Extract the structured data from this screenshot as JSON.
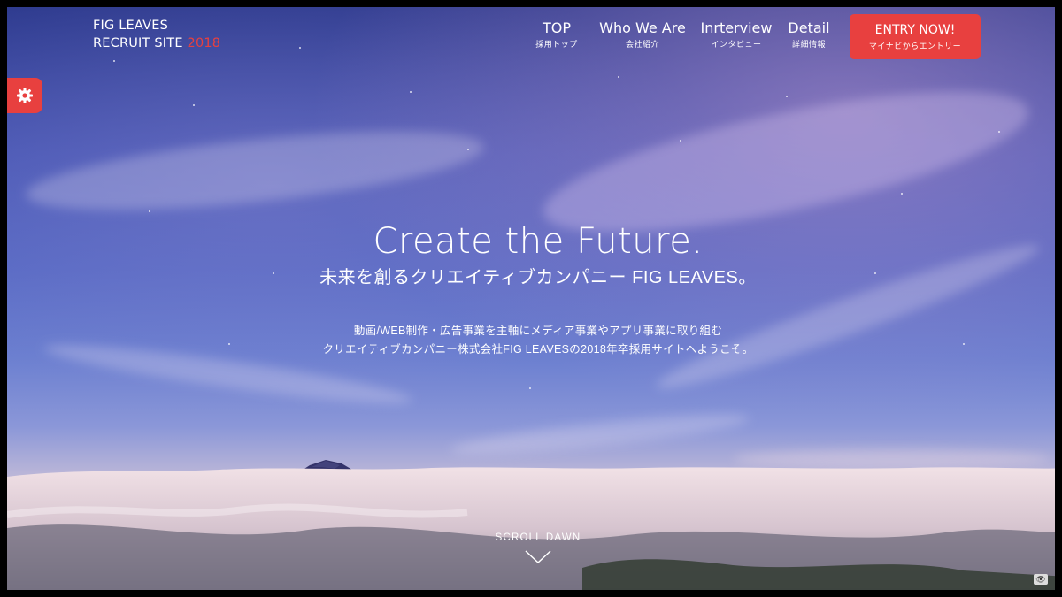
{
  "logo": {
    "line1": "FIG LEAVES",
    "line2_prefix": "RECRUIT SITE",
    "line2_year": "2018"
  },
  "nav": {
    "items": [
      {
        "label": "TOP",
        "sub": "採用トップ"
      },
      {
        "label": "Who We Are",
        "sub": "会社紹介"
      },
      {
        "label": "Inrterview",
        "sub": "インタビュー"
      },
      {
        "label": "Detail",
        "sub": "詳細情報"
      }
    ],
    "entry": {
      "label": "ENTRY NOW!",
      "sub": "マイナビからエントリー"
    }
  },
  "side_tab": {
    "icon": "gear-icon"
  },
  "hero": {
    "headline": "Create the Future.",
    "subhead": "未来を創るクリエイティブカンパニー FIG LEAVES。",
    "desc_line1": "動画/WEB制作・広告事業を主軸にメディア事業やアプリ事業に取り組む",
    "desc_line2": "クリエイティブカンパニー株式会社FIG LEAVESの2018年卒採用サイトへようこそ。"
  },
  "scroll": {
    "label": "SCROLL DAWN",
    "icon": "chevron-down-icon"
  },
  "corner": {
    "icon": "eye-icon",
    "glyph": "👁"
  },
  "colors": {
    "accent": "#e8403f",
    "text": "#ffffff"
  }
}
